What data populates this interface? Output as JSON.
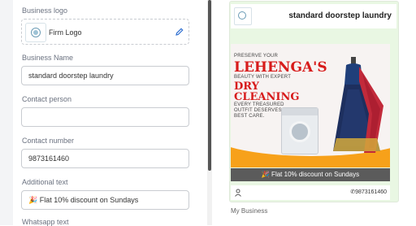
{
  "form": {
    "business_logo_label": "Business logo",
    "logo_text": "Firm Logo",
    "business_name_label": "Business Name",
    "business_name_value": "standard doorstep laundry",
    "contact_person_label": "Contact person",
    "contact_person_value": "",
    "contact_number_label": "Contact number",
    "contact_number_value": "9873161460",
    "additional_text_label": "Additional text",
    "additional_text_value": "🎉 Flat 10% discount on Sundays",
    "whatsapp_text_label": "Whatsapp text"
  },
  "preview": {
    "business_name": "standard doorstep laundry",
    "poster": {
      "line1": "PRESERVE YOUR",
      "line2": "LEHENGA'S",
      "line3": "BEAUTY WITH EXPERT",
      "line4": "DRY",
      "line5": "CLEANING",
      "line6": "EVERY TREASURED",
      "line7": "OUTFIT DESERVES THE",
      "line8": "BEST CARE."
    },
    "discount_text": "🎉 Flat 10% discount on Sundays",
    "phone": "9873161460",
    "caption": "My Business"
  },
  "colors": {
    "accent": "#d71b1b",
    "orange": "#f7a11a",
    "card_bg": "#e9f7e3"
  },
  "icons": [
    "pencil-icon",
    "person-icon",
    "phone-icon",
    "party-icon"
  ]
}
